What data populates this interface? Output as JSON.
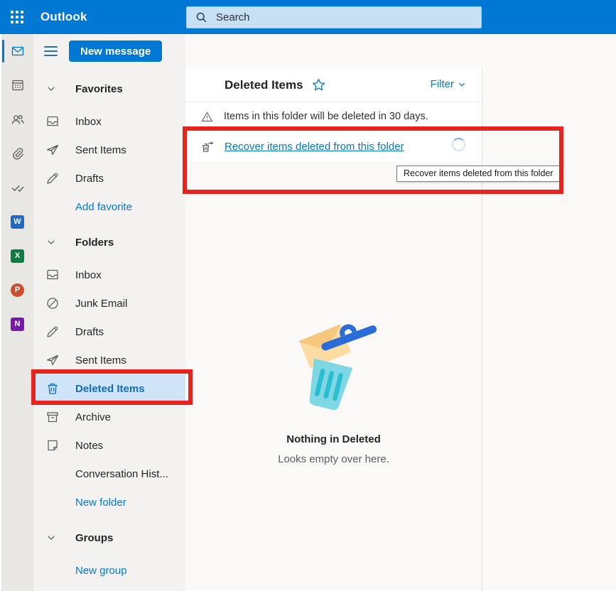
{
  "topbar": {
    "brand": "Outlook",
    "search_placeholder": "Search"
  },
  "toolbar": {
    "new_message_label": "New message"
  },
  "rail": {
    "items": [
      {
        "name": "mail",
        "icon": "mail",
        "selected": true
      },
      {
        "name": "calendar",
        "icon": "calendar",
        "selected": false
      },
      {
        "name": "people",
        "icon": "people",
        "selected": false
      },
      {
        "name": "attachments",
        "icon": "paperclip",
        "selected": false
      },
      {
        "name": "tasks",
        "icon": "checks",
        "selected": false
      },
      {
        "name": "word",
        "letter": "W",
        "color": "#2368c4",
        "shape": "tile"
      },
      {
        "name": "excel",
        "letter": "X",
        "color": "#107c41",
        "shape": "tile"
      },
      {
        "name": "powerpoint",
        "letter": "P",
        "color": "#cb4f2e",
        "shape": "disc"
      },
      {
        "name": "onenote",
        "letter": "N",
        "color": "#7719aa",
        "shape": "tile"
      }
    ]
  },
  "sidebar": {
    "sections": [
      {
        "label": "Favorites",
        "items": [
          {
            "label": "Inbox",
            "icon": "inbox"
          },
          {
            "label": "Sent Items",
            "icon": "send"
          },
          {
            "label": "Drafts",
            "icon": "pencil"
          },
          {
            "label": "Add favorite",
            "icon": null,
            "link": true
          }
        ]
      },
      {
        "label": "Folders",
        "items": [
          {
            "label": "Inbox",
            "icon": "inbox"
          },
          {
            "label": "Junk Email",
            "icon": "block"
          },
          {
            "label": "Drafts",
            "icon": "pencil"
          },
          {
            "label": "Sent Items",
            "icon": "send"
          },
          {
            "label": "Deleted Items",
            "icon": "trash",
            "selected": true
          },
          {
            "label": "Archive",
            "icon": "archive"
          },
          {
            "label": "Notes",
            "icon": "note"
          },
          {
            "label": "Conversation Hist...",
            "icon": null
          },
          {
            "label": "New folder",
            "icon": null,
            "link": true
          }
        ]
      },
      {
        "label": "Groups",
        "items": [
          {
            "label": "New group",
            "icon": null,
            "link": true
          }
        ]
      }
    ]
  },
  "main": {
    "title": "Deleted Items",
    "filter_label": "Filter",
    "notice": "Items in this folder will be deleted in 30 days.",
    "recover_link_label": "Recover items deleted from this folder",
    "tooltip": "Recover items deleted from this folder",
    "empty_state": {
      "title": "Nothing in Deleted",
      "subtitle": "Looks empty over here."
    }
  },
  "annotations": {
    "color": "#e8231d",
    "boxes": [
      "recover-items-area",
      "sidebar-deleted-items"
    ]
  },
  "colors": {
    "accent": "#0078d4",
    "selected_text": "#0f6cbd",
    "selected_bg": "#cfe4f7",
    "topbar": "#0078d4"
  }
}
